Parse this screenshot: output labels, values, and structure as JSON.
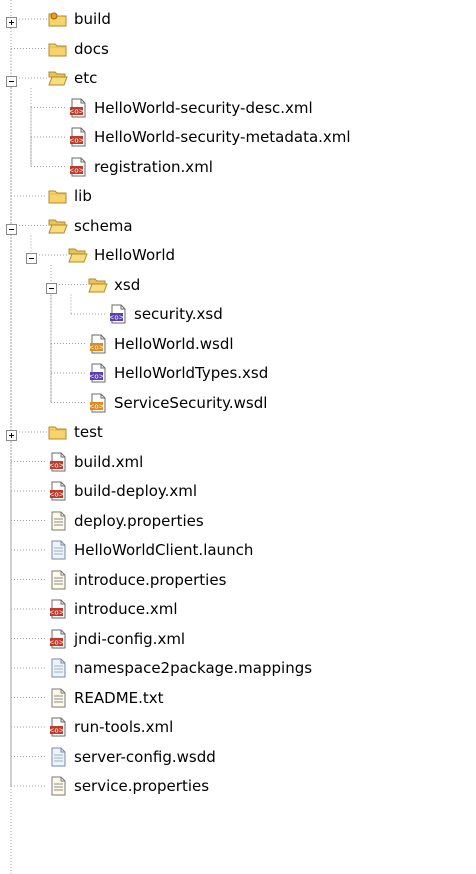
{
  "tree": [
    {
      "label": "build",
      "icon": "folder-shared-icon",
      "depth": 0,
      "expander": "plus"
    },
    {
      "label": "docs",
      "icon": "folder-icon",
      "depth": 0,
      "expander": "none"
    },
    {
      "label": "etc",
      "icon": "folder-open-icon",
      "depth": 0,
      "expander": "minus"
    },
    {
      "label": "HelloWorld-security-desc.xml",
      "icon": "xml-file-icon",
      "depth": 1,
      "expander": "none"
    },
    {
      "label": "HelloWorld-security-metadata.xml",
      "icon": "xml-file-icon",
      "depth": 1,
      "expander": "none"
    },
    {
      "label": "registration.xml",
      "icon": "xml-file-icon",
      "depth": 1,
      "expander": "none"
    },
    {
      "label": "lib",
      "icon": "folder-icon",
      "depth": 0,
      "expander": "none"
    },
    {
      "label": "schema",
      "icon": "folder-open-icon",
      "depth": 0,
      "expander": "minus"
    },
    {
      "label": "HelloWorld",
      "icon": "folder-open-icon",
      "depth": 1,
      "expander": "minus"
    },
    {
      "label": "xsd",
      "icon": "folder-open-icon",
      "depth": 2,
      "expander": "minus"
    },
    {
      "label": "security.xsd",
      "icon": "xsd-file-icon",
      "depth": 3,
      "expander": "none"
    },
    {
      "label": "HelloWorld.wsdl",
      "icon": "wsdl-file-icon",
      "depth": 2,
      "expander": "none"
    },
    {
      "label": "HelloWorldTypes.xsd",
      "icon": "xsd-file-icon",
      "depth": 2,
      "expander": "none"
    },
    {
      "label": "ServiceSecurity.wsdl",
      "icon": "wsdl-file-icon",
      "depth": 2,
      "expander": "none"
    },
    {
      "label": "test",
      "icon": "folder-icon",
      "depth": 0,
      "expander": "plus"
    },
    {
      "label": "build.xml",
      "icon": "xml-file-icon",
      "depth": 0,
      "expander": "none"
    },
    {
      "label": "build-deploy.xml",
      "icon": "xml-file-icon",
      "depth": 0,
      "expander": "none"
    },
    {
      "label": "deploy.properties",
      "icon": "text-file-icon",
      "depth": 0,
      "expander": "none"
    },
    {
      "label": "HelloWorldClient.launch",
      "icon": "generic-file-icon",
      "depth": 0,
      "expander": "none"
    },
    {
      "label": "introduce.properties",
      "icon": "text-file-icon",
      "depth": 0,
      "expander": "none"
    },
    {
      "label": "introduce.xml",
      "icon": "xml-file-icon",
      "depth": 0,
      "expander": "none"
    },
    {
      "label": "jndi-config.xml",
      "icon": "xml-file-icon",
      "depth": 0,
      "expander": "none"
    },
    {
      "label": "namespace2package.mappings",
      "icon": "generic-file-icon",
      "depth": 0,
      "expander": "none"
    },
    {
      "label": "README.txt",
      "icon": "text-file-icon",
      "depth": 0,
      "expander": "none"
    },
    {
      "label": "run-tools.xml",
      "icon": "xml-file-icon",
      "depth": 0,
      "expander": "none"
    },
    {
      "label": "server-config.wsdd",
      "icon": "generic-file-icon",
      "depth": 0,
      "expander": "none"
    },
    {
      "label": "service.properties",
      "icon": "text-file-icon",
      "depth": 0,
      "expander": "none"
    }
  ]
}
